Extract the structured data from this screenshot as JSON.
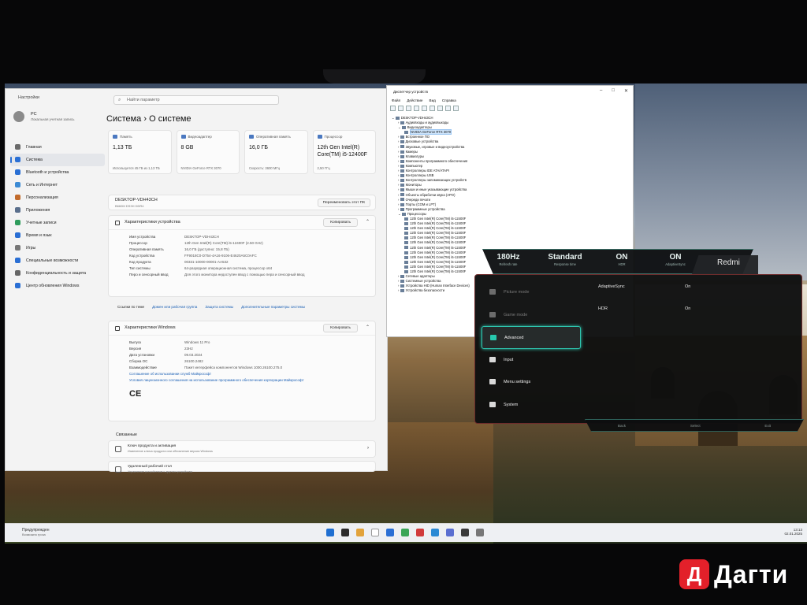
{
  "settings": {
    "window_title": "Настройки",
    "search_placeholder": "Найти параметр",
    "user_name": "PC",
    "user_sub": "Локальная учетная запись",
    "breadcrumb": "Система  ›  О системе",
    "nav": [
      {
        "label": "Главная",
        "color": "#6a6a6a"
      },
      {
        "label": "Система",
        "color": "#2a6fd4"
      },
      {
        "label": "Bluetooth и устройства",
        "color": "#2a6fd4"
      },
      {
        "label": "Сеть и Интернет",
        "color": "#3d8bd4"
      },
      {
        "label": "Персонализация",
        "color": "#c26b2b"
      },
      {
        "label": "Приложения",
        "color": "#5a6f8c"
      },
      {
        "label": "Учетные записи",
        "color": "#2f9c5c"
      },
      {
        "label": "Время и язык",
        "color": "#2a6fd4"
      },
      {
        "label": "Игры",
        "color": "#777777"
      },
      {
        "label": "Специальные возможности",
        "color": "#2a6fd4"
      },
      {
        "label": "Конфиденциальность и защита",
        "color": "#666666"
      },
      {
        "label": "Центр обновления Windows",
        "color": "#2a6fd4"
      }
    ],
    "cards": [
      {
        "title": "Память",
        "value": "1,13 ТБ",
        "sub": "Используется 45 ГБ из 1,13 ТБ"
      },
      {
        "title": "Видеоадаптер",
        "value": "8 GB",
        "sub": "NVIDIA GeForce RTX 3070"
      },
      {
        "title": "Оперативная память",
        "value": "16,0 ГБ",
        "sub": "Скорость: 3600 МГц"
      },
      {
        "title": "Процессор",
        "value": "12th Gen Intel(R) Core(TM) i5-12400F",
        "sub": "2,50 ГГц"
      }
    ],
    "device_name": "DESKTOP-VDH43CH",
    "device_sub": "B660M DS3H DDR4",
    "rename_label": "Переименовать этот ПК",
    "specs_title": "Характеристики устройства",
    "copy_label": "Копировать",
    "specs": [
      {
        "k": "Имя устройства",
        "v": "DESKTOP-VDH43CH"
      },
      {
        "k": "Процессор",
        "v": "12th Gen Intel(R) Core(TM) i5-12400F (2.50 GHz)"
      },
      {
        "k": "Оперативная память",
        "v": "16,0 ГБ (доступно: 15,8 ГБ)"
      },
      {
        "k": "Код устройства",
        "v": "FF9018C0-D754-4A16-9106-E4620A5C0AFC"
      },
      {
        "k": "Код продукта",
        "v": "00331-10000-00001-AA532"
      },
      {
        "k": "Тип системы",
        "v": "64-разрядная операционная система, процессор x64"
      },
      {
        "k": "Перо и сенсорный ввод",
        "v": "Для этого монитора недоступен ввод с помощью пера и сенсорный ввод"
      }
    ],
    "links_label": "Ссылки по теме",
    "links": [
      "Домен или рабочая группа",
      "Защита системы",
      "Дополнительные параметры системы"
    ],
    "win_title": "Характеристики Windows",
    "win_specs": [
      {
        "k": "Выпуск",
        "v": "Windows 11 Pro"
      },
      {
        "k": "Версия",
        "v": "23H2"
      },
      {
        "k": "Дата установки",
        "v": "09.03.2024"
      },
      {
        "k": "Сборка ОС",
        "v": "26100.2482"
      },
      {
        "k": "Взаимодействие",
        "v": "Пакет интерфейса компонентов Windows 1000.26100.275.0"
      }
    ],
    "license_links": [
      "Соглашение об использовании служб Майкрософт",
      "Условия лицензионного соглашения на использование программного обеспечения корпорации Майкрософт"
    ],
    "ce_mark": "CE",
    "related_title": "Связанные",
    "related": [
      {
        "title": "Ключ продукта и активация",
        "sub": "Изменение ключа продукта или обновление версии Windows"
      },
      {
        "title": "Удаленный рабочий стол",
        "sub": "Управление устройством с другого устройства"
      }
    ]
  },
  "devmgr": {
    "title": "Диспетчер устройств",
    "menu": [
      "Файл",
      "Действие",
      "Вид",
      "Справка"
    ],
    "tree": [
      {
        "label": "DESKTOP-VDH43CH",
        "indent": 0
      },
      {
        "label": "Аудиовходы и аудиовыходы",
        "indent": 1
      },
      {
        "label": "Видеоадаптеры",
        "indent": 1
      },
      {
        "label": "NVIDIA GeForce RTX 3070",
        "indent": 2,
        "selected": true
      },
      {
        "label": "Встроенное ПО",
        "indent": 1
      },
      {
        "label": "Дисковые устройства",
        "indent": 1
      },
      {
        "label": "Звуковые, игровые и видеоустройства",
        "indent": 1
      },
      {
        "label": "Камеры",
        "indent": 1
      },
      {
        "label": "Клавиатуры",
        "indent": 1
      },
      {
        "label": "Компоненты программного обеспечения",
        "indent": 1
      },
      {
        "label": "Компьютер",
        "indent": 1
      },
      {
        "label": "Контроллеры IDE ATA/ATAPI",
        "indent": 1
      },
      {
        "label": "Контроллеры USB",
        "indent": 1
      },
      {
        "label": "Контроллеры запоминающих устройств",
        "indent": 1
      },
      {
        "label": "Мониторы",
        "indent": 1
      },
      {
        "label": "Мыши и иные указывающие устройства",
        "indent": 1
      },
      {
        "label": "Объекты обработки звука (APO)",
        "indent": 1
      },
      {
        "label": "Очереди печати",
        "indent": 1
      },
      {
        "label": "Порты (COM и LPT)",
        "indent": 1
      },
      {
        "label": "Программные устройства",
        "indent": 1
      },
      {
        "label": "Процессоры",
        "indent": 1
      },
      {
        "label": "12th Gen Intel(R) Core(TM) i5-12400F",
        "indent": 2
      },
      {
        "label": "12th Gen Intel(R) Core(TM) i5-12400F",
        "indent": 2
      },
      {
        "label": "12th Gen Intel(R) Core(TM) i5-12400F",
        "indent": 2
      },
      {
        "label": "12th Gen Intel(R) Core(TM) i5-12400F",
        "indent": 2
      },
      {
        "label": "12th Gen Intel(R) Core(TM) i5-12400F",
        "indent": 2
      },
      {
        "label": "12th Gen Intel(R) Core(TM) i5-12400F",
        "indent": 2
      },
      {
        "label": "12th Gen Intel(R) Core(TM) i5-12400F",
        "indent": 2
      },
      {
        "label": "12th Gen Intel(R) Core(TM) i5-12400F",
        "indent": 2
      },
      {
        "label": "12th Gen Intel(R) Core(TM) i5-12400F",
        "indent": 2
      },
      {
        "label": "12th Gen Intel(R) Core(TM) i5-12400F",
        "indent": 2
      },
      {
        "label": "12th Gen Intel(R) Core(TM) i5-12400F",
        "indent": 2
      },
      {
        "label": "12th Gen Intel(R) Core(TM) i5-12400F",
        "indent": 2
      },
      {
        "label": "Сетевые адаптеры",
        "indent": 1
      },
      {
        "label": "Системные устройства",
        "indent": 1
      },
      {
        "label": "Устройства HID (Human Interface Devices)",
        "indent": 1
      },
      {
        "label": "Устройства безопасности",
        "indent": 1
      }
    ]
  },
  "taskbar": {
    "weather_title": "Предупрежден",
    "weather_sub": "Возможна гроза",
    "time": "13:13",
    "date": "02.01.2025",
    "icon_colors": [
      "#1f6fd1",
      "#2b2b2b",
      "#e2a33b",
      "#ffffff",
      "#2a6fd4",
      "#3aa657",
      "#d13b3b",
      "#2b8ad4",
      "#5a6fd1",
      "#3a3a3a",
      "#777777"
    ]
  },
  "osd": {
    "stats": [
      {
        "value": "180Hz",
        "label": "Refresh rate"
      },
      {
        "value": "Standard",
        "label": "Response time"
      },
      {
        "value": "ON",
        "label": "HDR"
      },
      {
        "value": "ON",
        "label": "AdaptiveSync"
      }
    ],
    "brand": "Redmi",
    "menu": [
      {
        "label": "Picture mode",
        "dim": true,
        "icon": "picture-mode-icon"
      },
      {
        "label": "Game mode",
        "dim": true,
        "icon": "game-mode-icon"
      },
      {
        "label": "Advanced",
        "active": true,
        "icon": "advanced-icon"
      },
      {
        "label": "Input",
        "icon": "input-icon"
      },
      {
        "label": "Menu settings",
        "icon": "menu-settings-icon"
      },
      {
        "label": "System",
        "icon": "system-icon"
      }
    ],
    "options": [
      {
        "name": "AdaptiveSync",
        "value": "On"
      },
      {
        "name": "HDR",
        "value": "On"
      }
    ],
    "footer": [
      "Back",
      "Select",
      "Exit"
    ],
    "accent": "#2ec7b0"
  },
  "watermark": {
    "letter": "Д",
    "text": "Дагти",
    "color": "#e3202a"
  }
}
